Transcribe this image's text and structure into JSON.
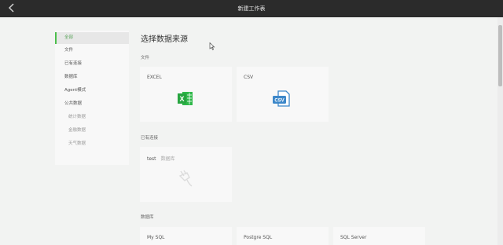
{
  "header": {
    "title": "新建工作表",
    "back_icon": "chevron-left-icon"
  },
  "page": {
    "heading": "选择数据来源"
  },
  "sidebar": {
    "items": [
      {
        "label": "全部",
        "active": true
      },
      {
        "label": "文件"
      },
      {
        "label": "已有连接"
      },
      {
        "label": "数据库"
      },
      {
        "label": "Agent模式"
      },
      {
        "label": "公共数据"
      },
      {
        "label": "统计数据",
        "sub": true
      },
      {
        "label": "金融数据",
        "sub": true
      },
      {
        "label": "天气数据",
        "sub": true
      }
    ]
  },
  "sections": {
    "file": {
      "label": "文件",
      "cards": [
        {
          "name": "EXCEL",
          "icon": "excel-icon"
        },
        {
          "name": "CSV",
          "icon": "csv-icon"
        }
      ]
    },
    "connections": {
      "label": "已有连接",
      "cards": [
        {
          "name": "test",
          "sub": "数据库",
          "icon": "plug-icon"
        }
      ]
    },
    "database": {
      "label": "数据库",
      "cards": [
        {
          "name": "My SQL"
        },
        {
          "name": "Postgre SQL"
        },
        {
          "name": "SQL Server"
        }
      ]
    }
  },
  "colors": {
    "accent": "#4cbf4c",
    "excel": "#2fb84a",
    "csv": "#3c87c9",
    "topbar": "#2b2b2b"
  }
}
